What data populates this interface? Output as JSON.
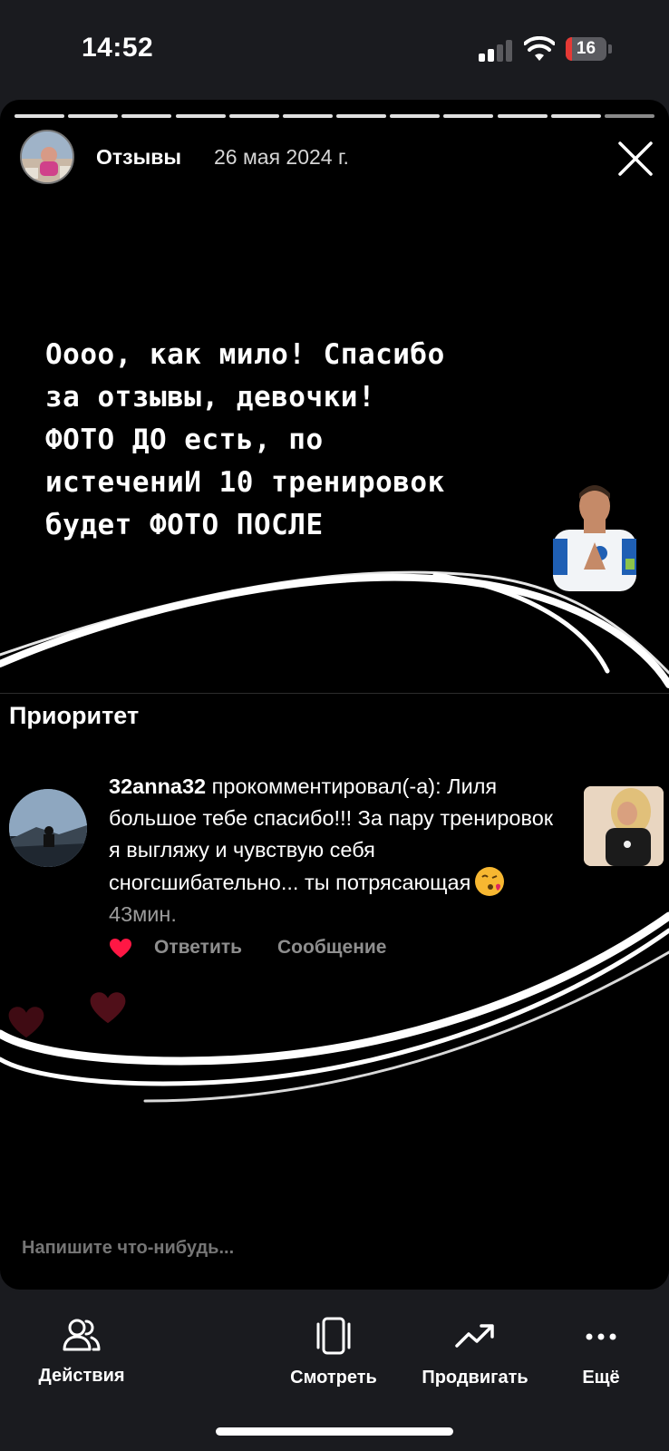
{
  "status_bar": {
    "time": "14:52",
    "battery_level": "16",
    "battery_percent": 16,
    "battery_color": "#e53935",
    "icons": [
      "cellular-signal-icon",
      "wifi-icon",
      "battery-icon"
    ]
  },
  "story": {
    "segments_total": 12,
    "segments_viewed": 11,
    "author": "Отзывы",
    "date": "26 мая 2024 г.",
    "caption": "Оооо, как мило!  Спасибо\nза отзывы, девочки!\nФОТО ДО есть, по\nистечениИ 10 тренировок\nбудет ФОТО ПОСЛЕ"
  },
  "comment_card": {
    "section_title": "Приоритет",
    "username": "32anna32",
    "action": " прокомментировал(-а): ",
    "text": "Лиля большое тебе спасибо!!! За пару тренировок я выгляжу и чувствую себя сногсшибательно... ты потрясающая",
    "emoji": "face-blowing-kiss",
    "time": "43мин.",
    "reply_label": "Ответить",
    "message_label": "Сообщение",
    "liked": true
  },
  "reply_input": {
    "placeholder": "Напишите что-нибудь..."
  },
  "bottom_nav": [
    {
      "label": "Действия",
      "icon": "people-icon"
    },
    {
      "label": "Смотреть",
      "icon": "view-icon"
    },
    {
      "label": "Продвигать",
      "icon": "trending-up-icon"
    },
    {
      "label": "Ещё",
      "icon": "more-icon"
    }
  ]
}
